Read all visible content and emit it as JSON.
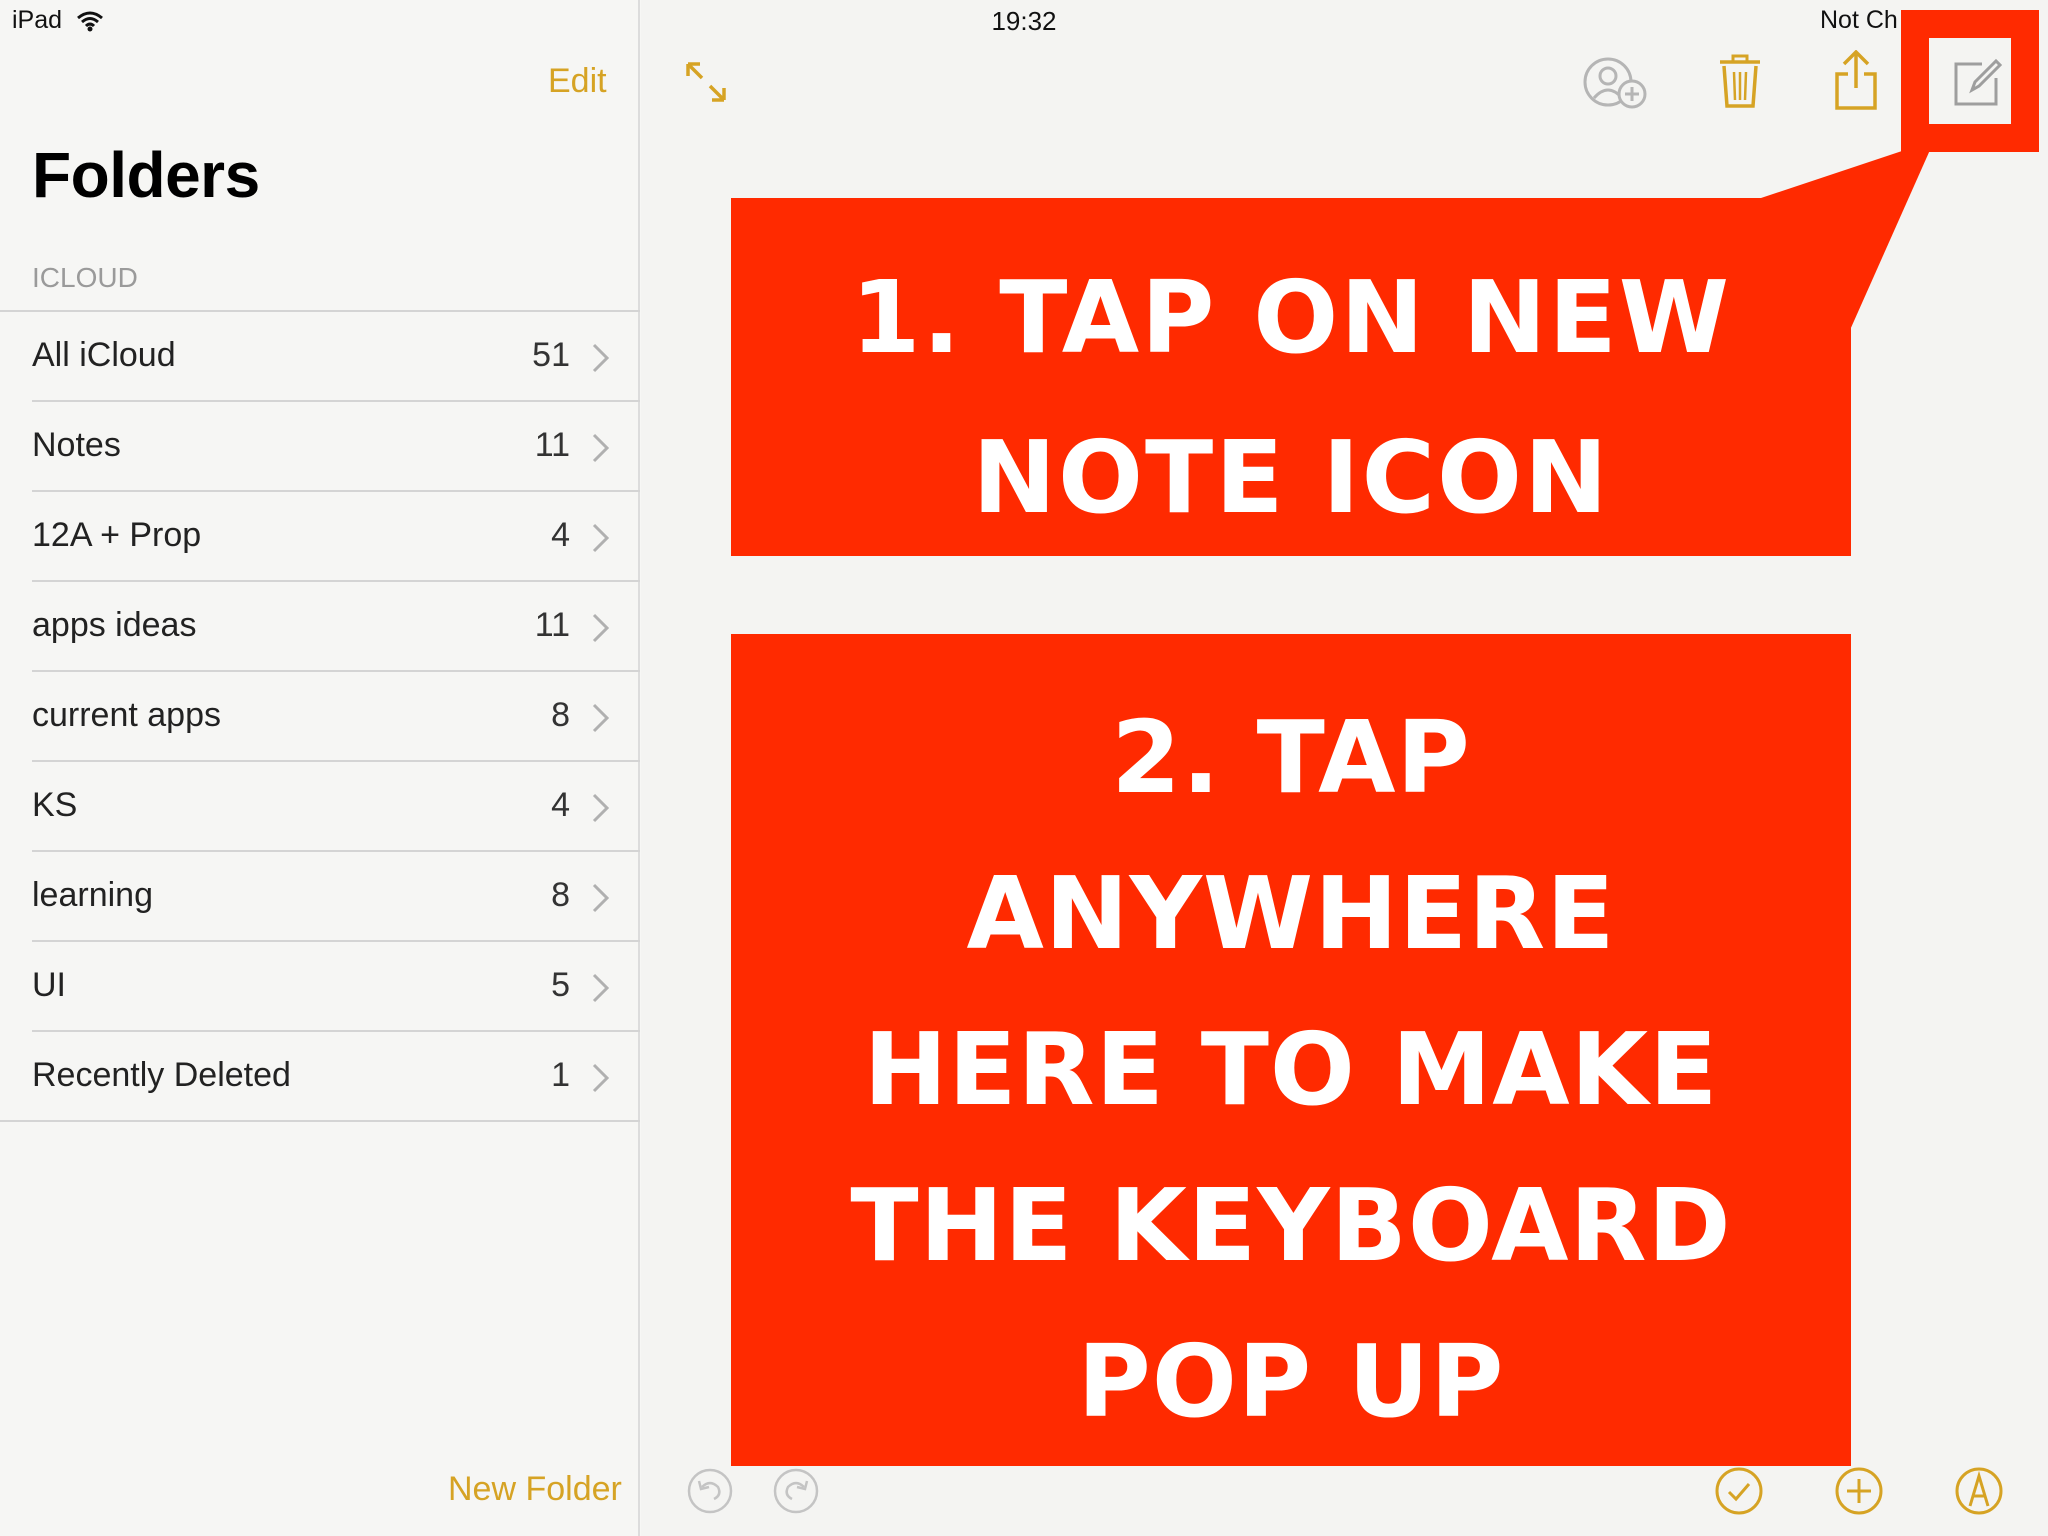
{
  "status_bar": {
    "device": "iPad",
    "time": "19:32",
    "right_text": "Not Ch"
  },
  "sidebar": {
    "edit_label": "Edit",
    "title": "Folders",
    "section_label": "ICLOUD",
    "items": [
      {
        "label": "All iCloud",
        "count": "51"
      },
      {
        "label": "Notes",
        "count": "11"
      },
      {
        "label": "12A + Prop",
        "count": "4"
      },
      {
        "label": "apps ideas",
        "count": "11"
      },
      {
        "label": "current apps",
        "count": "8"
      },
      {
        "label": "KS",
        "count": "4"
      },
      {
        "label": "learning",
        "count": "8"
      },
      {
        "label": "UI",
        "count": "5"
      },
      {
        "label": "Recently Deleted",
        "count": "1"
      }
    ],
    "new_folder_label": "New Folder"
  },
  "toolbar": {
    "icons": [
      "expand-icon",
      "add-person-icon",
      "trash-icon",
      "share-icon",
      "compose-icon"
    ]
  },
  "bottom_toolbar": {
    "icons": [
      "undo-icon",
      "redo-icon",
      "checklist-icon",
      "add-icon",
      "markup-icon"
    ]
  },
  "callouts": {
    "step1": {
      "line1": "1. TAP ON NEW",
      "line2": "NOTE ICON"
    },
    "step2": {
      "line1": "2. TAP",
      "line2": "ANYWHERE",
      "line3": "HERE TO MAKE",
      "line4": "THE KEYBOARD",
      "line5": "POP UP"
    }
  },
  "colors": {
    "accent": "#d6a324",
    "callout": "#ff2a00",
    "icon_gray": "#b5b5b5"
  }
}
